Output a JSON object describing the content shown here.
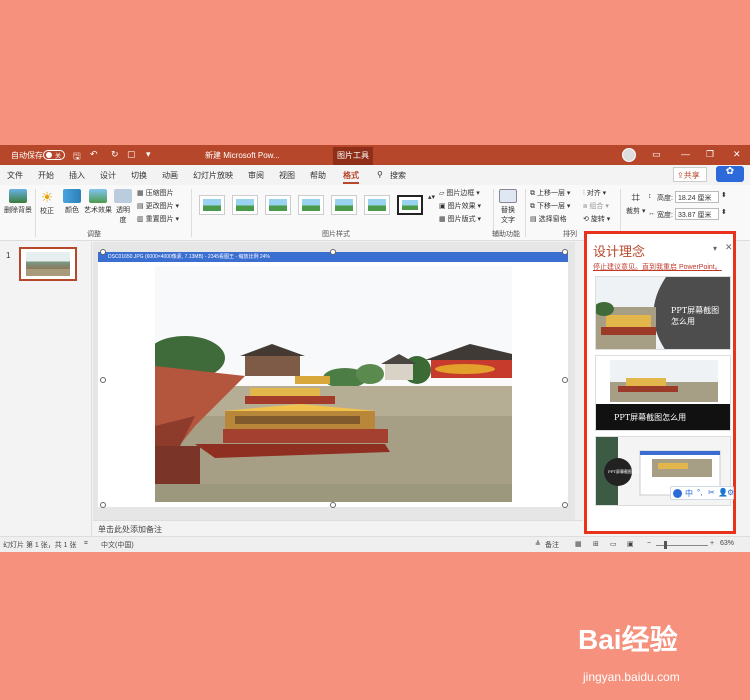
{
  "titlebar": {
    "autosave_label": "自动保存",
    "autosave_state": "关",
    "doc_title": "新建 Microsoft Pow...",
    "context_tools": "图片工具",
    "search_label": "搜索"
  },
  "tabs": [
    "文件",
    "开始",
    "插入",
    "设计",
    "切换",
    "动画",
    "幻灯片放映",
    "审阅",
    "视图",
    "帮助",
    "格式"
  ],
  "active_tab": "格式",
  "share_label": "共享",
  "ribbon": {
    "remove_bg": "删除背景",
    "correct": "校正",
    "color": "颜色",
    "art_effects": "艺术效果",
    "transparency": "透明度",
    "compress": "压缩图片",
    "change": "更改图片",
    "reset": "重置图片",
    "adjust_group": "调整",
    "picture_styles_group": "图片样式",
    "border": "图片边框",
    "effects": "图片效果",
    "layout": "图片版式",
    "alt_text": "替换文字",
    "accessibility_group": "辅助功能",
    "bring_forward": "上移一层",
    "send_backward": "下移一层",
    "selection_pane": "选择窗格",
    "align": "对齐",
    "group": "组合",
    "rotate": "旋转",
    "arrange_group": "排列",
    "crop": "裁剪",
    "height_label": "高度:",
    "height_value": "18.24 厘米",
    "width_label": "宽度:",
    "width_value": "33.87 厘米"
  },
  "slide_number": "1",
  "screenshot_bar": "DSC01650.JPG (6000×4000像素, 7.13MB) - 2345看图王 - 缩放比例 24%",
  "notes_placeholder": "单击此处添加备注",
  "status": {
    "slide_info": "幻灯片 第 1 张，共 1 张",
    "language": "中文(中国)",
    "notes_btn": "备注",
    "zoom": "63%"
  },
  "design_pane": {
    "title": "设计理念",
    "link": "停止建议意见。直到我重启 PowerPoint。",
    "option1_text": "PPT屏幕截图\n怎么用",
    "option2_text": "PPT屏幕截图怎么用",
    "option3_text": "PPT屏幕截图怎么用"
  },
  "ime_bar": "中",
  "watermark": {
    "brand": "Bai经验",
    "url": "jingyan.baidu.com"
  },
  "colors": {
    "accent": "#B7472A",
    "background": "#F5917C",
    "highlight": "#e8321c"
  }
}
